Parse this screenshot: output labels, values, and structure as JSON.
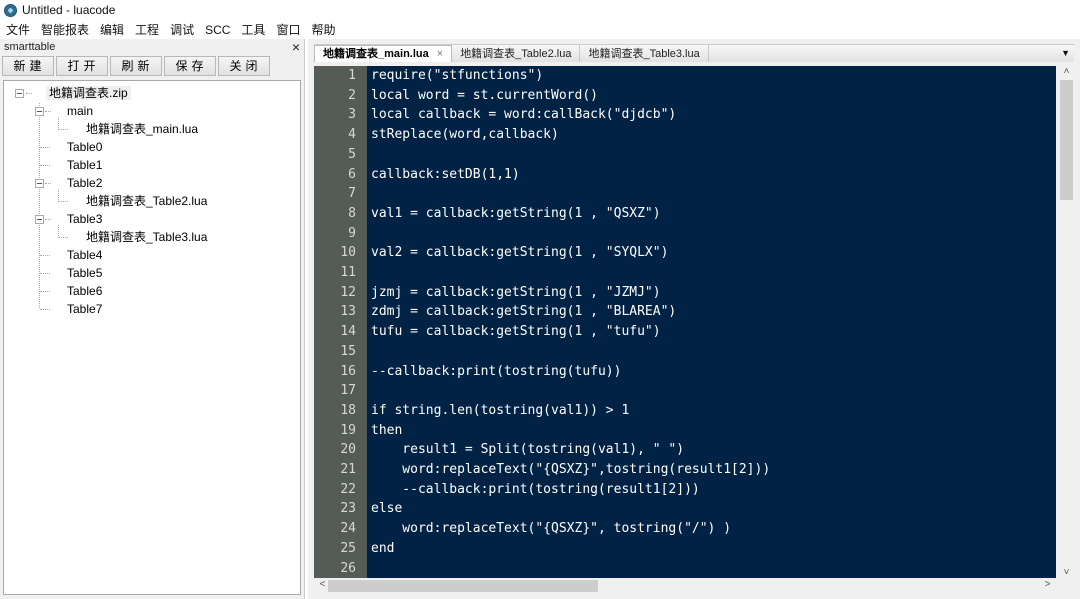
{
  "window": {
    "title": "Untitled - luacode"
  },
  "menu": [
    "文件",
    "智能报表",
    "编辑",
    "工程",
    "调试",
    "SCC",
    "工具",
    "窗口",
    "帮助"
  ],
  "panel": {
    "title": "smarttable",
    "close_icon": "×",
    "buttons": [
      "新建",
      "打开",
      "刷新",
      "保存",
      "关闭"
    ],
    "tree": {
      "root": "地籍调查表.zip",
      "items": [
        {
          "label": "main",
          "level": 1,
          "expanded": true
        },
        {
          "label": "地籍调查表_main.lua",
          "level": 2
        },
        {
          "label": "Table0",
          "level": 1
        },
        {
          "label": "Table1",
          "level": 1
        },
        {
          "label": "Table2",
          "level": 1,
          "expanded": true
        },
        {
          "label": "地籍调查表_Table2.lua",
          "level": 2
        },
        {
          "label": "Table3",
          "level": 1,
          "expanded": true
        },
        {
          "label": "地籍调查表_Table3.lua",
          "level": 2
        },
        {
          "label": "Table4",
          "level": 1
        },
        {
          "label": "Table5",
          "level": 1
        },
        {
          "label": "Table6",
          "level": 1
        },
        {
          "label": "Table7",
          "level": 1
        }
      ]
    }
  },
  "tabs": [
    {
      "label": "地籍调查表_main.lua",
      "active": true,
      "close_icon": "×"
    },
    {
      "label": "地籍调查表_Table2.lua",
      "active": false
    },
    {
      "label": "地籍调查表_Table3.lua",
      "active": false
    }
  ],
  "tab_menu_icon": "▼",
  "editor": {
    "colors": {
      "background": "#002244",
      "gutter": "#555b55",
      "text": "#ffffff"
    },
    "lines": [
      "require(\"stfunctions\")",
      "local word = st.currentWord()",
      "local callback = word:callBack(\"djdcb\")",
      "stReplace(word,callback)",
      "",
      "callback:setDB(1,1)",
      "",
      "val1 = callback:getString(1 , \"QSXZ\")",
      "",
      "val2 = callback:getString(1 , \"SYQLX\")",
      "",
      "jzmj = callback:getString(1 , \"JZMJ\")",
      "zdmj = callback:getString(1 , \"BLAREA\")",
      "tufu = callback:getString(1 , \"tufu\")",
      "",
      "--callback:print(tostring(tufu))",
      "",
      "if string.len(tostring(val1)) > 1",
      "then",
      "    result1 = Split(tostring(val1), \" \")",
      "    word:replaceText(\"{QSXZ}\",tostring(result1[2]))",
      "    --callback:print(tostring(result1[2]))",
      "else",
      "    word:replaceText(\"{QSXZ}\", tostring(\"/\") )",
      "end",
      ""
    ]
  },
  "scrollbars": {
    "up": "˄",
    "down": "˅",
    "left": "<",
    "right": ">"
  }
}
